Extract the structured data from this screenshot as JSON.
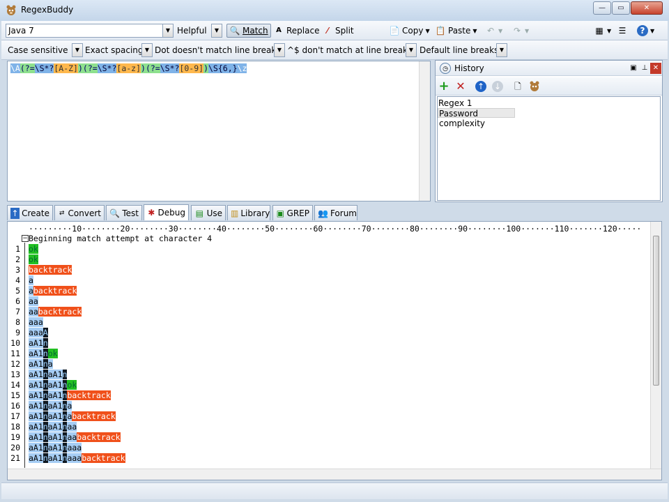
{
  "window": {
    "title": "RegexBuddy"
  },
  "toolbar1": {
    "flavor": "Java 7",
    "helpful": "Helpful",
    "match": "Match",
    "replace": "Replace",
    "split": "Split",
    "copy": "Copy",
    "paste": "Paste"
  },
  "toolbar2": {
    "case": "Case sensitive",
    "spacing": "Exact spacing",
    "dot": "Dot doesn't match line breaks",
    "caret": "^$ don't match at line breaks",
    "linebreaks": "Default line breaks"
  },
  "regex": {
    "parts": [
      "\\A",
      "(?=",
      "\\S*?",
      "[A-Z]",
      ")",
      "(?=",
      "\\S*?",
      "[a-z]",
      ")",
      "(?=",
      "\\S*?",
      "[0-9]",
      ")",
      "\\S{6,}",
      "\\z"
    ]
  },
  "history": {
    "title": "History",
    "items": [
      "Regex 1",
      "Password complexity"
    ]
  },
  "tabs": [
    "Create",
    "Convert",
    "Test",
    "Debug",
    "Use",
    "Library",
    "GREP",
    "Forum"
  ],
  "debug": {
    "ruler": "·········10········20········30········40········50········60········70········80········90········100·······110·······120·····",
    "header": "Beginning match attempt at character 4",
    "lines": [
      {
        "n": "1",
        "segs": [
          [
            "ok",
            "g"
          ]
        ]
      },
      {
        "n": "2",
        "segs": [
          [
            "ok",
            "g"
          ]
        ]
      },
      {
        "n": "3",
        "segs": [
          [
            "backtrack",
            "o"
          ]
        ]
      },
      {
        "n": "4",
        "segs": [
          [
            "a",
            "b"
          ]
        ]
      },
      {
        "n": "5",
        "segs": [
          [
            "a",
            "b"
          ],
          [
            "backtrack",
            "o"
          ]
        ]
      },
      {
        "n": "6",
        "segs": [
          [
            "aa",
            "b"
          ]
        ]
      },
      {
        "n": "7",
        "segs": [
          [
            "aa",
            "b"
          ],
          [
            "backtrack",
            "o"
          ]
        ]
      },
      {
        "n": "8",
        "segs": [
          [
            "aaa",
            "b"
          ]
        ]
      },
      {
        "n": "9",
        "segs": [
          [
            "aaa",
            "b"
          ],
          [
            "A",
            "d"
          ]
        ]
      },
      {
        "n": "10",
        "segs": [
          [
            "aA1",
            "b"
          ],
          [
            "n",
            "d"
          ]
        ]
      },
      {
        "n": "11",
        "segs": [
          [
            "aA1",
            "b"
          ],
          [
            "n",
            "d"
          ],
          [
            "ok",
            "g"
          ]
        ]
      },
      {
        "n": "12",
        "segs": [
          [
            "aA1",
            "b"
          ],
          [
            "n",
            "d"
          ],
          [
            "a",
            "b"
          ]
        ]
      },
      {
        "n": "13",
        "segs": [
          [
            "aA1",
            "b"
          ],
          [
            "n",
            "d"
          ],
          [
            "aA1",
            "b"
          ],
          [
            "n",
            "d"
          ]
        ]
      },
      {
        "n": "14",
        "segs": [
          [
            "aA1",
            "b"
          ],
          [
            "n",
            "d"
          ],
          [
            "aA1",
            "b"
          ],
          [
            "n",
            "d"
          ],
          [
            "ok",
            "g"
          ]
        ]
      },
      {
        "n": "15",
        "segs": [
          [
            "aA1",
            "b"
          ],
          [
            "n",
            "d"
          ],
          [
            "aA1",
            "b"
          ],
          [
            "n",
            "d"
          ],
          [
            "backtrack",
            "o"
          ]
        ]
      },
      {
        "n": "16",
        "segs": [
          [
            "aA1",
            "b"
          ],
          [
            "n",
            "d"
          ],
          [
            "aA1",
            "b"
          ],
          [
            "n",
            "d"
          ],
          [
            "a",
            "b"
          ]
        ]
      },
      {
        "n": "17",
        "segs": [
          [
            "aA1",
            "b"
          ],
          [
            "n",
            "d"
          ],
          [
            "aA1",
            "b"
          ],
          [
            "n",
            "d"
          ],
          [
            "a",
            "b"
          ],
          [
            "backtrack",
            "o"
          ]
        ]
      },
      {
        "n": "18",
        "segs": [
          [
            "aA1",
            "b"
          ],
          [
            "n",
            "d"
          ],
          [
            "aA1",
            "b"
          ],
          [
            "n",
            "d"
          ],
          [
            "aa",
            "b"
          ]
        ]
      },
      {
        "n": "19",
        "segs": [
          [
            "aA1",
            "b"
          ],
          [
            "n",
            "d"
          ],
          [
            "aA1",
            "b"
          ],
          [
            "n",
            "d"
          ],
          [
            "aa",
            "b"
          ],
          [
            "backtrack",
            "o"
          ]
        ]
      },
      {
        "n": "20",
        "segs": [
          [
            "aA1",
            "b"
          ],
          [
            "n",
            "d"
          ],
          [
            "aA1",
            "b"
          ],
          [
            "n",
            "d"
          ],
          [
            "aaa",
            "b"
          ]
        ]
      },
      {
        "n": "21",
        "segs": [
          [
            "aA1",
            "b"
          ],
          [
            "n",
            "d"
          ],
          [
            "aA1",
            "b"
          ],
          [
            "n",
            "d"
          ],
          [
            "aaa",
            "b"
          ],
          [
            "backtrack",
            "o"
          ]
        ]
      }
    ]
  }
}
